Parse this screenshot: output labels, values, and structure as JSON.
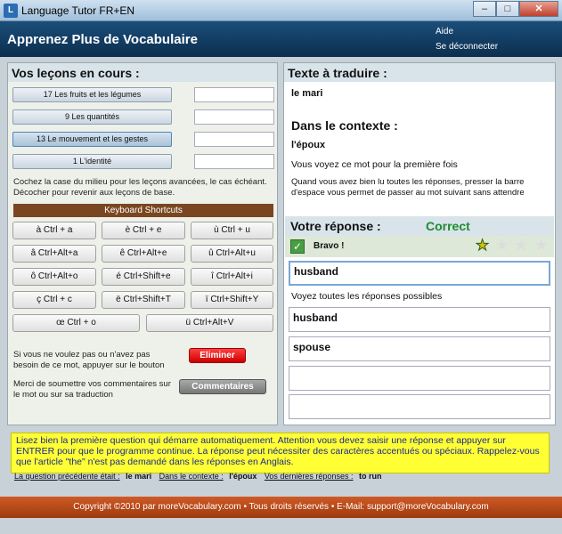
{
  "window": {
    "title": "Language Tutor FR+EN",
    "icon": "app-logo-icon"
  },
  "header": {
    "title": "Apprenez Plus de Vocabulaire",
    "help": "Aide",
    "logout": "Se déconnecter"
  },
  "lessons": {
    "heading": "Vos leçons en cours :",
    "items": [
      {
        "label": "17 Les fruits et les légumes",
        "value": ""
      },
      {
        "label": "9 Les quantités",
        "value": ""
      },
      {
        "label": "13 Le mouvement et les gestes",
        "value": ""
      },
      {
        "label": "1 L'identité",
        "value": ""
      }
    ],
    "note": "Cochez la case du milieu pour les leçons avancées, le cas échéant. Décocher pour revenir aux leçons de base."
  },
  "shortcuts": {
    "heading": "Keyboard Shortcuts",
    "rows": [
      [
        "à  Ctrl + a",
        "è  Ctrl + e",
        "ù  Ctrl + u"
      ],
      [
        "â  Ctrl+Alt+a",
        "ê  Ctrl+Alt+e",
        "û  Ctrl+Alt+u"
      ],
      [
        "ô  Ctrl+Alt+o",
        "é  Ctrl+Shift+e",
        "î  Ctrl+Alt+i"
      ],
      [
        "ç  Ctrl + c",
        "ë  Ctrl+Shift+T",
        "ï  Ctrl+Shift+Y"
      ],
      [
        "œ  Ctrl + o",
        "ü  Ctrl+Alt+V"
      ]
    ]
  },
  "actions": {
    "eliminate_text": "Si vous ne voulez pas ou n'avez pas besoin de ce mot, appuyer sur le bouton",
    "eliminate_button": "Eliminer",
    "comment_text": "Merci de soumettre vos commentaires sur le mot ou sur sa traduction",
    "comment_button": "Commentaires"
  },
  "translate": {
    "heading": "Texte à traduire :",
    "word": "le mari",
    "context_heading": "Dans le contexte :",
    "context_word": "l'époux",
    "first_time": "Vous voyez ce mot pour la première fois",
    "instructions": "Quand vous avez bien lu toutes les réponses, presser la barre d'espace vous permet de passer au mot suivant sans attendre"
  },
  "answer": {
    "heading": "Votre réponse :",
    "status": "Correct",
    "feedback": "Bravo !",
    "check_icon": "checkmark-icon",
    "rating": {
      "filled": 1,
      "total": 4
    },
    "value": "husband",
    "all_label": "Voyez toutes les réponses possibles",
    "possible": [
      "husband",
      "spouse",
      "",
      ""
    ]
  },
  "info": {
    "text": "Lisez bien la première question qui démarre automatiquement. Attention vous devez saisir une réponse et appuyer sur ENTRER pour que le programme continue. La réponse peut nécessiter des caractères accentués ou spéciaux. Rappelez-vous que l'article \"the\" n'est pas demandé dans les réponses en Anglais.",
    "prev_question_label": "La question précédente était :",
    "prev_question_value": "le mari",
    "prev_context_label": "Dans le contexte :",
    "prev_context_value": "l'époux",
    "last_answers_label": "Vos dernières réponses :",
    "last_answers_value": "to run"
  },
  "footer": {
    "text": "Copyright ©2010 par moreVocabulary.com   •   Tous droits réservés   •   E-Mail:      support@moreVocabulary.com"
  },
  "colors": {
    "header": "#0c2e4e",
    "shortcut_header": "#7a4621",
    "correct": "#1e8a2e",
    "info_bg": "#ffff33",
    "footer": "#b84a1a",
    "eliminate": "#e00000"
  }
}
